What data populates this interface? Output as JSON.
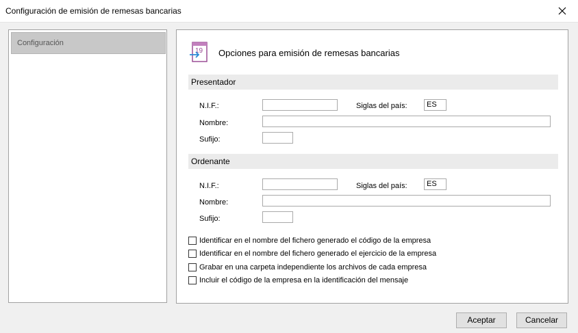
{
  "window": {
    "title": "Configuración de emisión de remesas bancarias"
  },
  "sidebar": {
    "items": [
      {
        "label": "Configuración"
      }
    ]
  },
  "panel": {
    "icon_text": "19",
    "title": "Opciones para emisión de remesas bancarias",
    "presentador": {
      "heading": "Presentador",
      "nif_label": "N.I.F.:",
      "nif_value": "",
      "siglas_label": "Siglas del país:",
      "siglas_value": "ES",
      "nombre_label": "Nombre:",
      "nombre_value": "",
      "sufijo_label": "Sufijo:",
      "sufijo_value": ""
    },
    "ordenante": {
      "heading": "Ordenante",
      "nif_label": "N.I.F.:",
      "nif_value": "",
      "siglas_label": "Siglas del país:",
      "siglas_value": "ES",
      "nombre_label": "Nombre:",
      "nombre_value": "",
      "sufijo_label": "Sufijo:",
      "sufijo_value": ""
    },
    "options": [
      {
        "label": "Identificar en el nombre del fichero generado el código de la empresa",
        "checked": false
      },
      {
        "label": "Identificar en el nombre del fichero generado el ejercicio de la empresa",
        "checked": false
      },
      {
        "label": "Grabar en una carpeta independiente los archivos de cada empresa",
        "checked": false
      },
      {
        "label": "Incluir el código de la empresa en la identificación del mensaje",
        "checked": false
      }
    ]
  },
  "buttons": {
    "accept": "Aceptar",
    "cancel": "Cancelar"
  },
  "icons": {
    "close": "close-icon",
    "header": "remesa-19-icon"
  },
  "colors": {
    "icon_accent": "#9b4f96",
    "arrow": "#2a8ad6"
  }
}
